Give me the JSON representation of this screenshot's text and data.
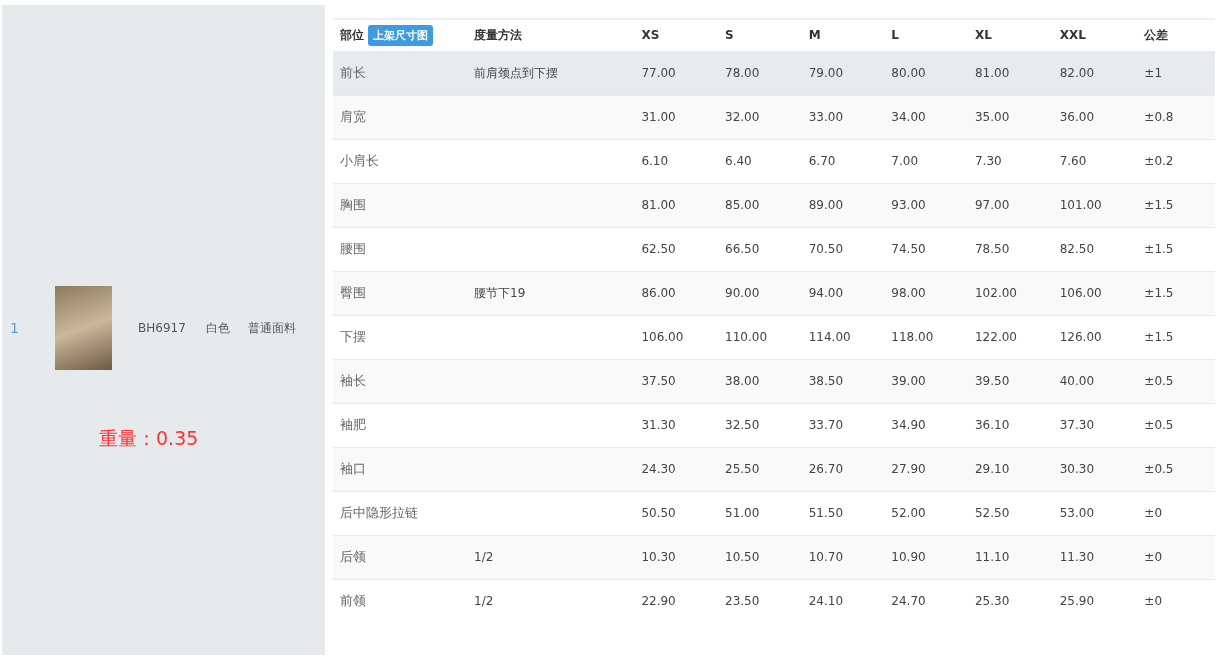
{
  "product": {
    "index": "1",
    "code": "BH6917",
    "color_name": "白色",
    "fabric": "普通面料",
    "weight": "重量：0.35"
  },
  "table": {
    "columns": [
      {
        "label": "部位",
        "badge": "上架尺寸图"
      },
      {
        "label": "度量方法"
      },
      {
        "label": "XS"
      },
      {
        "label": "S"
      },
      {
        "label": "M"
      },
      {
        "label": "L"
      },
      {
        "label": "XL"
      },
      {
        "label": "XXL"
      },
      {
        "label": "公差"
      }
    ],
    "rows": [
      {
        "selected": true,
        "cells": [
          "前长",
          "前肩颈点到下摆",
          "77.00",
          "78.00",
          "79.00",
          "80.00",
          "81.00",
          "82.00",
          "±1"
        ]
      },
      {
        "selected": false,
        "cells": [
          "肩宽",
          "",
          "31.00",
          "32.00",
          "33.00",
          "34.00",
          "35.00",
          "36.00",
          "±0.8"
        ]
      },
      {
        "selected": false,
        "cells": [
          "小肩长",
          "",
          "6.10",
          "6.40",
          "6.70",
          "7.00",
          "7.30",
          "7.60",
          "±0.2"
        ]
      },
      {
        "selected": false,
        "cells": [
          "胸围",
          "",
          "81.00",
          "85.00",
          "89.00",
          "93.00",
          "97.00",
          "101.00",
          "±1.5"
        ]
      },
      {
        "selected": false,
        "cells": [
          "腰围",
          "",
          "62.50",
          "66.50",
          "70.50",
          "74.50",
          "78.50",
          "82.50",
          "±1.5"
        ]
      },
      {
        "selected": false,
        "cells": [
          "臀围",
          "腰节下19",
          "86.00",
          "90.00",
          "94.00",
          "98.00",
          "102.00",
          "106.00",
          "±1.5"
        ]
      },
      {
        "selected": false,
        "cells": [
          "下摆",
          "",
          "106.00",
          "110.00",
          "114.00",
          "118.00",
          "122.00",
          "126.00",
          "±1.5"
        ]
      },
      {
        "selected": false,
        "cells": [
          "袖长",
          "",
          "37.50",
          "38.00",
          "38.50",
          "39.00",
          "39.50",
          "40.00",
          "±0.5"
        ]
      },
      {
        "selected": false,
        "cells": [
          "袖肥",
          "",
          "31.30",
          "32.50",
          "33.70",
          "34.90",
          "36.10",
          "37.30",
          "±0.5"
        ]
      },
      {
        "selected": false,
        "cells": [
          "袖口",
          "",
          "24.30",
          "25.50",
          "26.70",
          "27.90",
          "29.10",
          "30.30",
          "±0.5"
        ]
      },
      {
        "selected": false,
        "cells": [
          "后中隐形拉链",
          "",
          "50.50",
          "51.00",
          "51.50",
          "52.00",
          "52.50",
          "53.00",
          "±0"
        ]
      },
      {
        "selected": false,
        "cells": [
          "后领",
          "1/2",
          "10.30",
          "10.50",
          "10.70",
          "10.90",
          "11.10",
          "11.30",
          "±0"
        ]
      },
      {
        "selected": false,
        "cells": [
          "前领",
          "1/2",
          "22.90",
          "23.50",
          "24.10",
          "24.70",
          "25.30",
          "25.90",
          "±0"
        ]
      }
    ]
  }
}
